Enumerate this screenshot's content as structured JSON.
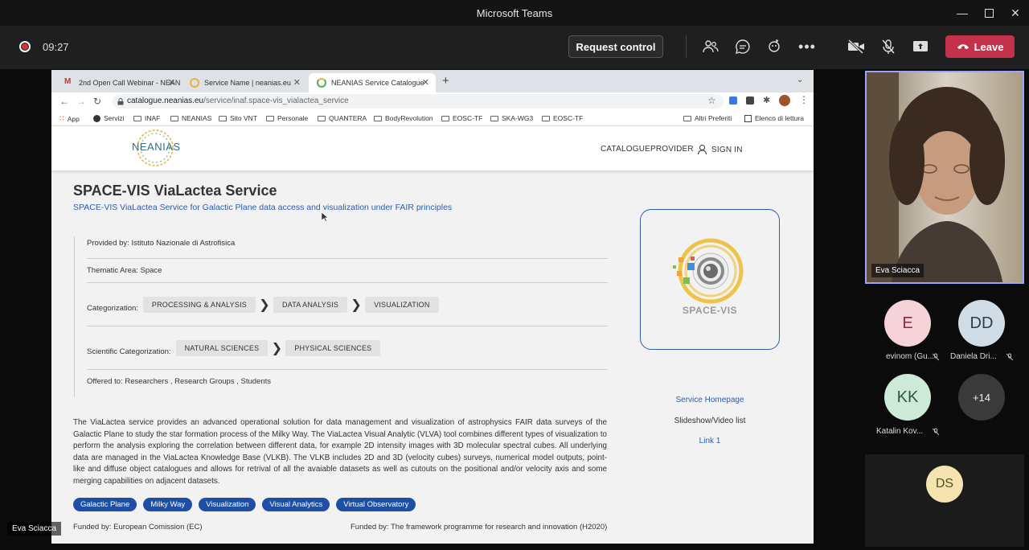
{
  "window": {
    "title": "Microsoft Teams"
  },
  "callbar": {
    "timer": "09:27",
    "request_control": "Request control",
    "leave": "Leave"
  },
  "browser": {
    "tabs": [
      {
        "label": "2nd Open Call Webinar - NEAN"
      },
      {
        "label": "Service Name | neanias.eu"
      },
      {
        "label": "NEANIAS Service Catalogue"
      }
    ],
    "url_host": "catalogue.neanias.eu",
    "url_path": "/service/inaf.space-vis_vialactea_service",
    "bookmarks": [
      "App",
      "Servizi",
      "INAF",
      "NEANIAS",
      "Sito VNT",
      "Personale",
      "QUANTERA",
      "BodyRevolution",
      "EOSC-TF",
      "SKA-WG3",
      "EOSC-TF"
    ],
    "other_bookmarks": "Altri Preferiti",
    "reading_list": "Elenco di lettura"
  },
  "site": {
    "logo_text": "NEANIAS",
    "nav": {
      "catalogue": "CATALOGUE",
      "provider": "PROVIDER",
      "sign_in": "SIGN IN"
    },
    "title": "SPACE-VIS ViaLactea Service",
    "subtitle": "SPACE-VIS ViaLactea Service for Galactic Plane data access and visualization under FAIR principles",
    "provided_by": "Provided by: Istituto Nazionale di Astrofisica",
    "thematic_area": "Thematic Area: Space",
    "categorization_label": "Categorization:",
    "categorization": [
      "PROCESSING & ANALYSIS",
      "DATA ANALYSIS",
      "VISUALIZATION"
    ],
    "scientific_label": "Scientific Categorization:",
    "scientific": [
      "NATURAL SCIENCES",
      "PHYSICAL SCIENCES"
    ],
    "offered_to": "Offered to: Researchers , Research Groups , Students",
    "description": "The ViaLactea service provides an advanced operational solution for data management and visualization of astrophysics FAIR data surveys of the Galactic Plane to study the star formation process of the Milky Way. The ViaLactea Visual Analytic (VLVA) tool combines different types of visualization to perform the analysis exploring the correlation between different data, for example 2D intensity images with 3D molecular spectral cubes. All underlying data are managed in the ViaLactea Knowledge Base (VLKB). The VLKB includes 2D and 3D (velocity cubes) surveys, numerical model outputs, point-like and diffuse object catalogues and allows for retrival of all the avaiable datasets as well as cutouts on the positional and/or velocity axis and some merging capabilities on adjacent datasets.",
    "tags": [
      "Galactic Plane",
      "Milky Way",
      "Visualization",
      "Visual Analytics",
      "Virtual Observatory"
    ],
    "funded_by_1": "Funded by: European Comission (EC)",
    "funded_by_2": "Funded by: The framework programme for research and innovation (H2020)",
    "card_logo_text": "SPACE-VIS",
    "links": {
      "homepage": "Service Homepage",
      "slideshow": "Slideshow/Video list",
      "link1": "Link 1"
    }
  },
  "participants": {
    "presenter": "Eva Sciacca",
    "list": [
      {
        "initials": "E",
        "name": "evinom (Gu..."
      },
      {
        "initials": "DD",
        "name": "Daniela Dri..."
      },
      {
        "initials": "KK",
        "name": "Katalin Kov..."
      },
      {
        "initials": "+14",
        "name": ""
      }
    ],
    "ds_initials": "DS",
    "shared_by": "Eva Sciacca"
  },
  "colors": {
    "leave": "#c4314b",
    "accent_blue": "#1f4fa5",
    "link_blue": "#2a5db0",
    "active_border": "#9ea2ff"
  }
}
